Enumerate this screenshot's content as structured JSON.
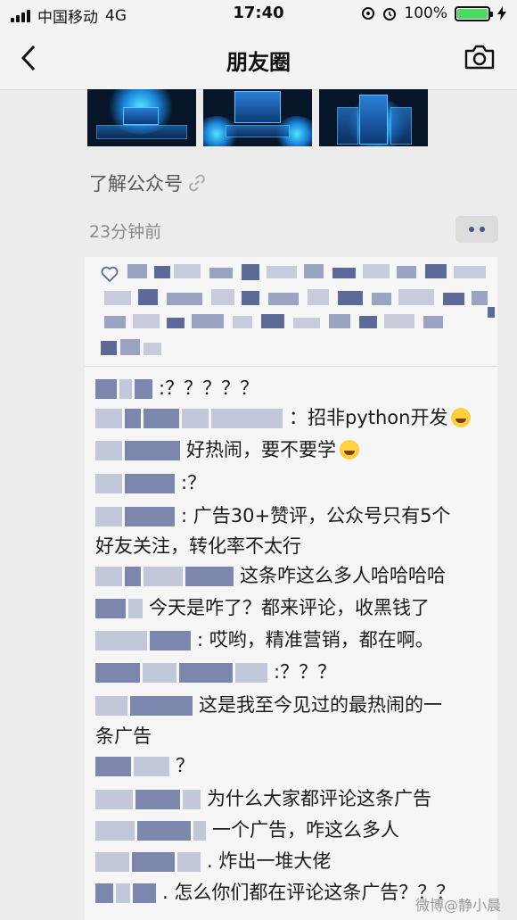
{
  "status_bar": {
    "carrier": "中国移动",
    "network": "4G",
    "time": "17:40",
    "battery": "100%",
    "battery_level": 1.0
  },
  "nav": {
    "title": "朋友圈"
  },
  "post": {
    "link_text": "了解公众号",
    "time": "23分钟前"
  },
  "comments": [
    {
      "text": ":？？？？？"
    },
    {
      "text": "：招非python开发"
    },
    {
      "text": "好热闹，要不要学"
    },
    {
      "text": ":？"
    },
    {
      "text": ": 广告30+赞评，公众号只有5个",
      "text2": "好友关注，转化率不太行"
    },
    {
      "text": "这条咋这么多人哈哈哈哈"
    },
    {
      "text": "今天是咋了？都来评论，收黑钱了"
    },
    {
      "text": ": 哎哟，精准营销，都在啊。"
    },
    {
      "text": ":？？？"
    },
    {
      "text": "这是我至今见过的最热闹的一",
      "text2": "条广告"
    },
    {
      "text": "？"
    },
    {
      "text": "为什么大家都评论这条广告"
    },
    {
      "text": "一个广告，咋这么多人"
    },
    {
      "text": ". 炸出一堆大佬"
    },
    {
      "text": ". 怎么你们都在评论这条广告？？？"
    }
  ],
  "watermark": "微博@静小晨",
  "icons": {
    "back": "chevron-left-icon",
    "camera": "camera-icon",
    "link": "link-icon",
    "like": "heart-icon",
    "more": "more-dots-icon"
  }
}
